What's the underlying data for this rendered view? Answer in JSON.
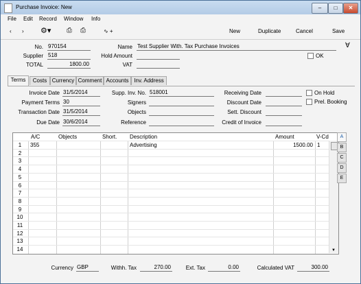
{
  "window": {
    "title": "Purchase Invoice: New"
  },
  "menu": [
    "File",
    "Edit",
    "Record",
    "Window",
    "Info"
  ],
  "toolbar": {
    "new": "New",
    "duplicate": "Duplicate",
    "cancel": "Cancel",
    "save": "Save"
  },
  "header": {
    "no_label": "No.",
    "no": "970154",
    "name_label": "Name",
    "name": "Test Supplier With. Tax Purchase Invoices",
    "supplier_label": "Supplier",
    "supplier": "518",
    "hold_amount_label": "Hold Amount",
    "hold_amount": "",
    "ok_label": "OK",
    "total_label": "TOTAL",
    "total": "1800.00",
    "vat_label": "VAT",
    "vat": ""
  },
  "tabs": [
    "Terms",
    "Costs",
    "Currency",
    "Comment",
    "Accounts",
    "Inv. Address"
  ],
  "terms": {
    "invoice_date_label": "Invoice Date",
    "invoice_date": "31/5/2014",
    "payment_terms_label": "Payment Terms",
    "payment_terms": "30",
    "transaction_date_label": "Transaction Date",
    "transaction_date": "31/5/2014",
    "due_date_label": "Due Date",
    "due_date": "30/6/2014",
    "supp_inv_no_label": "Supp. Inv. No.",
    "supp_inv_no": "518001",
    "signers_label": "Signers",
    "signers": "",
    "objects_label": "Objects",
    "objects": "",
    "reference_label": "Reference",
    "reference": "",
    "receiving_date_label": "Receiving Date",
    "receiving_date": "",
    "discount_date_label": "Discount Date",
    "discount_date": "",
    "sett_discount_label": "Sett. Discount",
    "sett_discount": "",
    "credit_of_invoice_label": "Credit of Invoice",
    "credit_of_invoice": "",
    "on_hold_label": "On Hold",
    "prel_booking_label": "Prel. Booking"
  },
  "grid": {
    "headers": [
      "A/C",
      "Objects",
      "Short.",
      "Description",
      "Amount",
      "V-Cd"
    ],
    "rows": [
      {
        "n": "1",
        "ac": "355",
        "objects": "",
        "short": "",
        "description": "Advertising",
        "amount": "1500.00",
        "vcd": "1"
      },
      {
        "n": "2"
      },
      {
        "n": "3"
      },
      {
        "n": "4"
      },
      {
        "n": "5"
      },
      {
        "n": "6"
      },
      {
        "n": "7"
      },
      {
        "n": "8"
      },
      {
        "n": "9"
      },
      {
        "n": "10"
      },
      {
        "n": "11"
      },
      {
        "n": "12"
      },
      {
        "n": "13"
      },
      {
        "n": "14"
      }
    ],
    "side_tabs": [
      "A",
      "B",
      "C",
      "D",
      "E"
    ]
  },
  "footer": {
    "currency_label": "Currency",
    "currency": "GBP",
    "withh_tax_label": "Withh. Tax",
    "withh_tax": "270.00",
    "ext_tax_label": "Ext. Tax",
    "ext_tax": "0.00",
    "calculated_vat_label": "Calculated VAT",
    "calculated_vat": "300.00"
  }
}
